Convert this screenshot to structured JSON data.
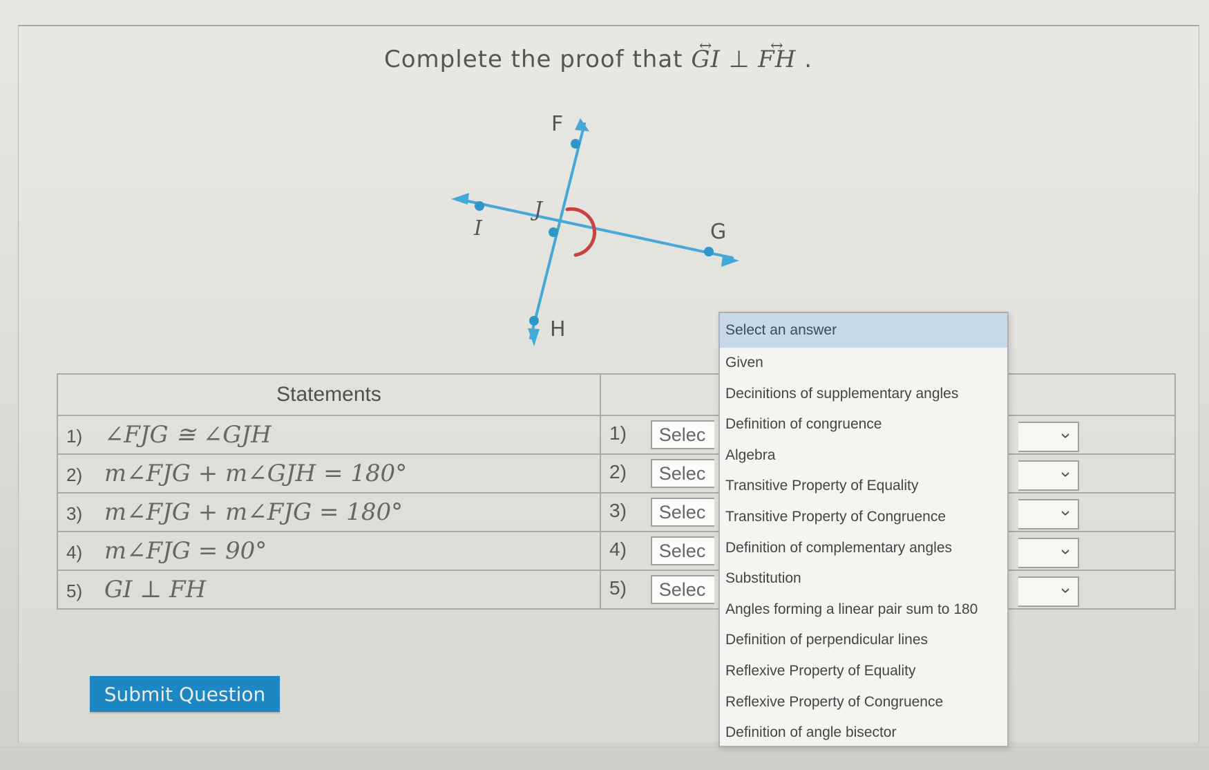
{
  "prompt": {
    "lead": "Complete the proof that ",
    "line1": "GI",
    "symbol": " ⊥ ",
    "line2": "FH",
    "end": "."
  },
  "diagram": {
    "labels": {
      "f": "F",
      "j": "J",
      "g": "G",
      "i": "I",
      "h": "H"
    },
    "colors": {
      "line": "#45a8d9",
      "angle": "#c74343",
      "point": "#2f96c8"
    }
  },
  "table": {
    "statements_header": "Statements",
    "reasons_header": "",
    "rows": [
      {
        "num": "1)",
        "statement": "∠FJG ≅ ∠GJH",
        "reason_num": "1)",
        "reason_value": "Selec"
      },
      {
        "num": "2)",
        "statement": "m∠FJG + m∠GJH = 180°",
        "reason_num": "2)",
        "reason_value": "Selec"
      },
      {
        "num": "3)",
        "statement": "m∠FJG + m∠FJG = 180°",
        "reason_num": "3)",
        "reason_value": "Selec"
      },
      {
        "num": "4)",
        "statement": "m∠FJG = 90°",
        "reason_num": "4)",
        "reason_value": "Selec"
      },
      {
        "num": "5)",
        "statement": "GI ⊥ FH",
        "reason_num": "5)",
        "reason_value": "Selec"
      }
    ]
  },
  "dropdown": {
    "options": [
      "Select an answer",
      "Given",
      "Decinitions of supplementary angles",
      "Definition of congruence",
      "Algebra",
      "Transitive Property of Equality",
      "Transitive Property of Congruence",
      "Definition of complementary angles",
      "Substitution",
      "Angles forming a linear pair sum to 180",
      "Definition of perpendicular lines",
      "Reflexive Property of Equality",
      "Reflexive Property of Congruence",
      "Definition of angle bisector"
    ]
  },
  "submit_label": "Submit Question",
  "icons": {
    "dropdown_chevron": "chevron-down-icon"
  }
}
